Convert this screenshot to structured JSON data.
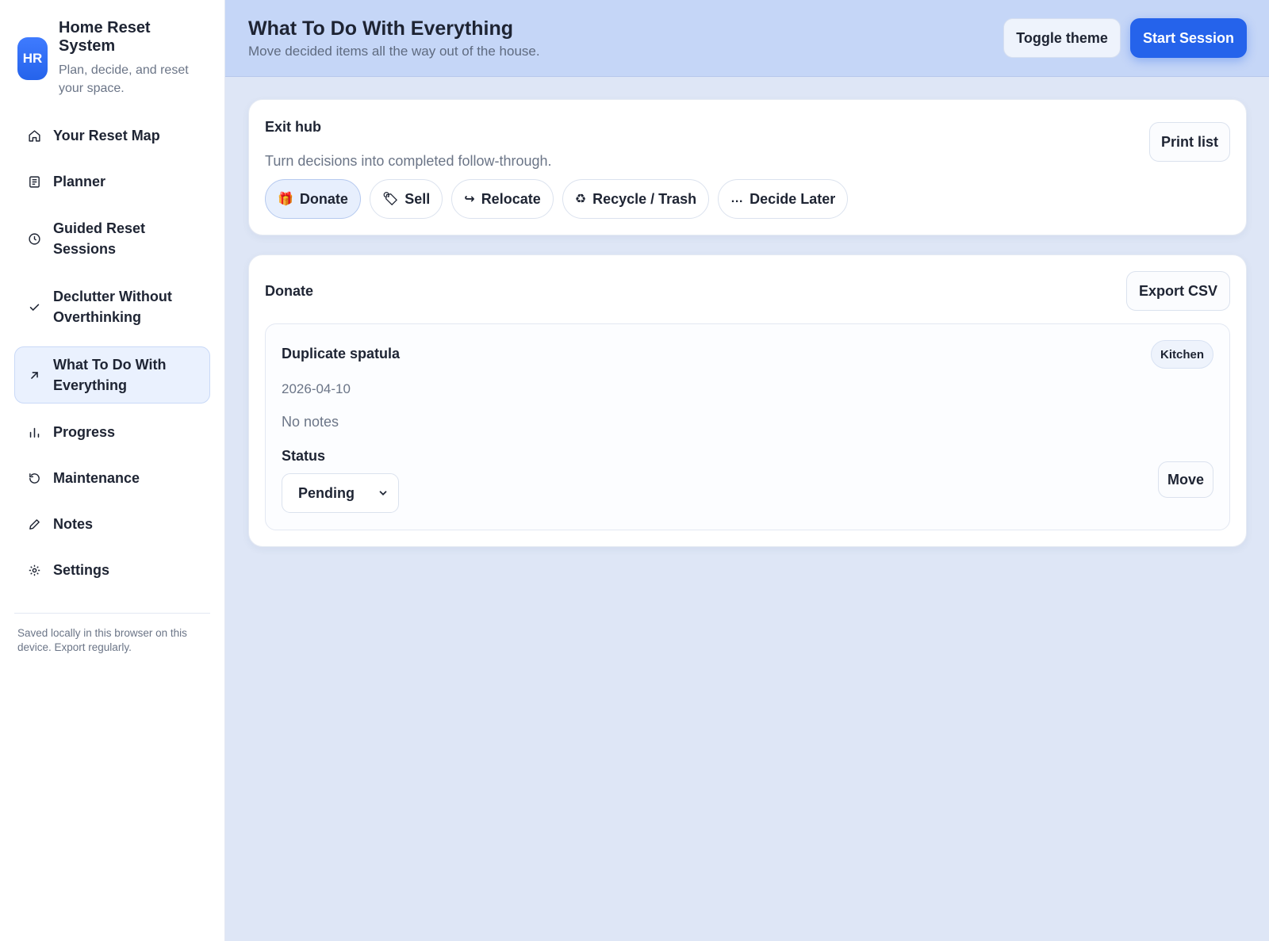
{
  "brand": {
    "initials": "HR",
    "title": "Home Reset System",
    "subtitle": "Plan, decide, and reset your space."
  },
  "sidebar": {
    "items": [
      {
        "label": "Your Reset Map",
        "icon": "home-icon"
      },
      {
        "label": "Planner",
        "icon": "list-icon"
      },
      {
        "label": "Guided Reset Sessions",
        "icon": "clock-icon"
      },
      {
        "label": "Declutter Without Overthinking",
        "icon": "check-icon"
      },
      {
        "label": "What To Do With Everything",
        "icon": "arrow-up-right-icon",
        "active": true
      },
      {
        "label": "Progress",
        "icon": "bar-chart-icon"
      },
      {
        "label": "Maintenance",
        "icon": "refresh-icon"
      },
      {
        "label": "Notes",
        "icon": "pencil-icon"
      },
      {
        "label": "Settings",
        "icon": "gear-icon"
      }
    ],
    "footer": "Saved locally in this browser on this device. Export regularly."
  },
  "header": {
    "title": "What To Do With Everything",
    "subtitle": "Move decided items all the way out of the house.",
    "toggle_theme": "Toggle theme",
    "start_session": "Start Session"
  },
  "hub": {
    "title": "Exit hub",
    "subtitle": "Turn decisions into completed follow-through.",
    "print": "Print list",
    "chips": [
      {
        "label": "Donate",
        "icon": "🎁",
        "active": true
      },
      {
        "label": "Sell",
        "icon": "🏷"
      },
      {
        "label": "Relocate",
        "icon": "↪"
      },
      {
        "label": "Recycle / Trash",
        "icon": "♻"
      },
      {
        "label": "Decide Later",
        "icon": "…"
      }
    ]
  },
  "section": {
    "title": "Donate",
    "export": "Export CSV",
    "item": {
      "name": "Duplicate spatula",
      "tag": "Kitchen",
      "date": "2026-04-10",
      "notes": "No notes",
      "status_label": "Status",
      "status_value": "Pending",
      "move": "Move"
    }
  },
  "colors": {
    "accent": "#2563eb",
    "header_bg": "#c5d6f7",
    "page_bg": "#dee6f6",
    "active_nav_bg": "#eaf1fe"
  }
}
